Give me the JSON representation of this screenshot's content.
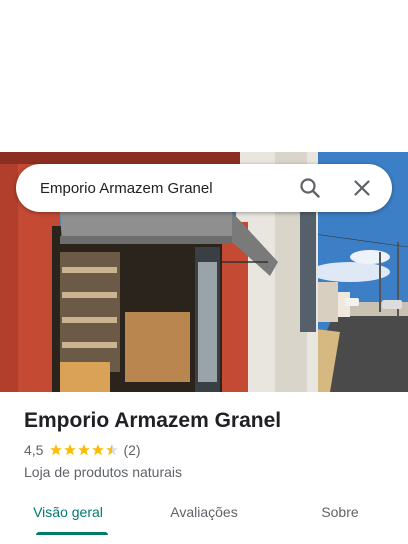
{
  "search": {
    "query": "Emporio Armazem Granel"
  },
  "place": {
    "name": "Emporio Armazem Granel",
    "rating": "4,5",
    "stars": 4.5,
    "review_count": "(2)",
    "category": "Loja de produtos naturais"
  },
  "tabs": [
    {
      "label": "Visão geral",
      "active": true
    },
    {
      "label": "Avaliações",
      "active": false
    },
    {
      "label": "Sobre",
      "active": false
    }
  ],
  "colors": {
    "accent": "#00796b",
    "star": "#fbbc04"
  },
  "icons": {
    "search": "search-icon",
    "close": "close-icon"
  }
}
